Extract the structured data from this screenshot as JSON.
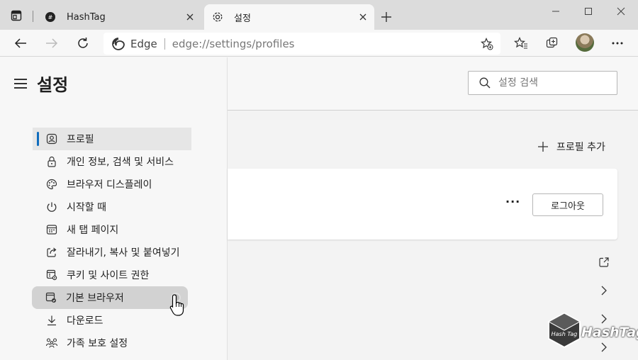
{
  "tabs": [
    {
      "title": "HashTag",
      "active": false
    },
    {
      "title": "설정",
      "active": true
    }
  ],
  "address": {
    "browser_name": "Edge",
    "url_scheme": "edge://",
    "url_path": "settings/profiles"
  },
  "sidebar": {
    "title": "설정",
    "items": [
      {
        "label": "프로필",
        "icon": "profile-icon",
        "selected": true
      },
      {
        "label": "개인 정보, 검색 및 서비스",
        "icon": "lock-icon"
      },
      {
        "label": "브라우저 디스플레이",
        "icon": "palette-icon"
      },
      {
        "label": "시작할 때",
        "icon": "power-icon"
      },
      {
        "label": "새 탭 페이지",
        "icon": "new-tab-page-icon"
      },
      {
        "label": "잘라내기, 복사 및 붙여넣기",
        "icon": "share-icon"
      },
      {
        "label": "쿠키 및 사이트 권한",
        "icon": "site-permissions-icon"
      },
      {
        "label": "기본 브라우저",
        "icon": "default-browser-icon",
        "hovered": true
      },
      {
        "label": "다운로드",
        "icon": "download-icon"
      },
      {
        "label": "가족 보호 설정",
        "icon": "family-icon"
      }
    ]
  },
  "search": {
    "placeholder": "설정 검색"
  },
  "main": {
    "add_profile_label": "프로필 추가",
    "more_label": "···",
    "logout_label": "로그아웃"
  },
  "watermark": {
    "text": "HashTag",
    "badge_text": "Hash Tag"
  },
  "colors": {
    "accent": "#0f6cbd",
    "tabstrip": "#dcdcdc"
  }
}
